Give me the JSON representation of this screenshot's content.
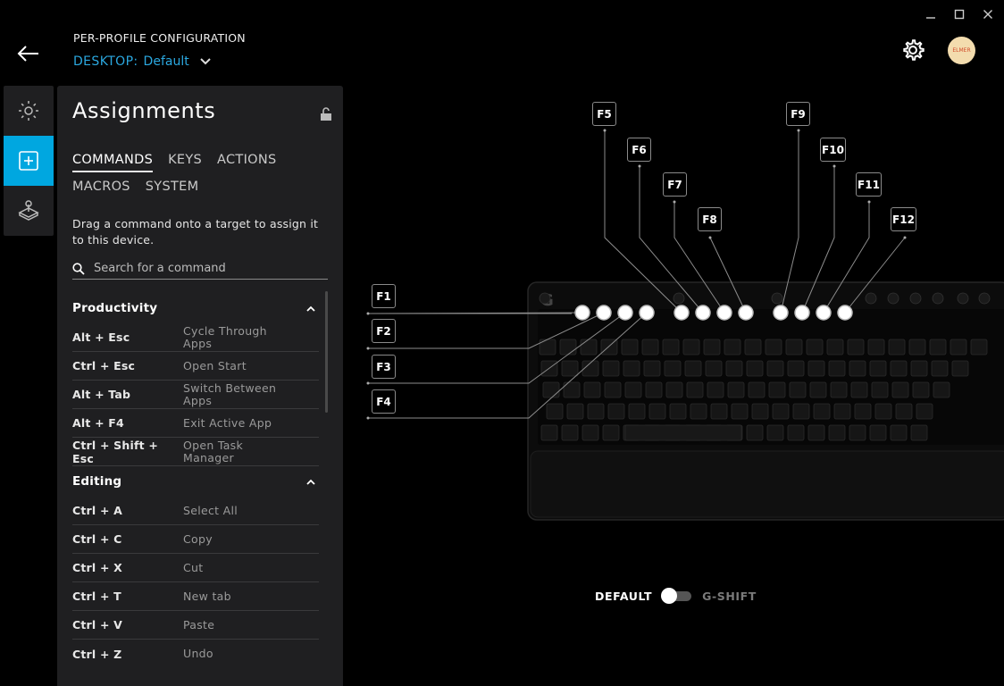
{
  "window": {
    "minimize": "—",
    "maximize": "☐",
    "close": "✕"
  },
  "header": {
    "title": "PER-PROFILE CONFIGURATION",
    "profile_prefix": "DESKTOP:",
    "profile_value": "Default"
  },
  "avatar_text": "ELMER",
  "panel": {
    "title": "Assignments",
    "tabs_row1": [
      "COMMANDS",
      "KEYS",
      "ACTIONS"
    ],
    "tabs_row2": [
      "MACROS",
      "SYSTEM"
    ],
    "hint": "Drag a command onto a target to assign it to this device.",
    "search_placeholder": "Search for a command",
    "groups": [
      {
        "title": "Productivity",
        "items": [
          {
            "key": "Alt + Esc",
            "name": "Cycle Through Apps"
          },
          {
            "key": "Ctrl + Esc",
            "name": "Open Start"
          },
          {
            "key": "Alt + Tab",
            "name": "Switch Between Apps"
          },
          {
            "key": "Alt + F4",
            "name": "Exit Active App"
          },
          {
            "key": "Ctrl + Shift + Esc",
            "name": "Open Task Manager"
          }
        ]
      },
      {
        "title": "Editing",
        "items": [
          {
            "key": "Ctrl + A",
            "name": "Select All"
          },
          {
            "key": "Ctrl + C",
            "name": "Copy"
          },
          {
            "key": "Ctrl + X",
            "name": "Cut"
          },
          {
            "key": "Ctrl + T",
            "name": "New tab"
          },
          {
            "key": "Ctrl + V",
            "name": "Paste"
          },
          {
            "key": "Ctrl + Z",
            "name": "Undo"
          }
        ]
      }
    ]
  },
  "keyboard": {
    "labels": [
      "F1",
      "F2",
      "F3",
      "F4",
      "F5",
      "F6",
      "F7",
      "F8",
      "F9",
      "F10",
      "F11",
      "F12"
    ]
  },
  "mode_toggle": {
    "left": "DEFAULT",
    "right": "G-SHIFT",
    "state": "DEFAULT"
  },
  "colors": {
    "accent": "#00a7e0",
    "profile_text": "#2ba8e0",
    "panel_bg": "#1f1f21"
  }
}
